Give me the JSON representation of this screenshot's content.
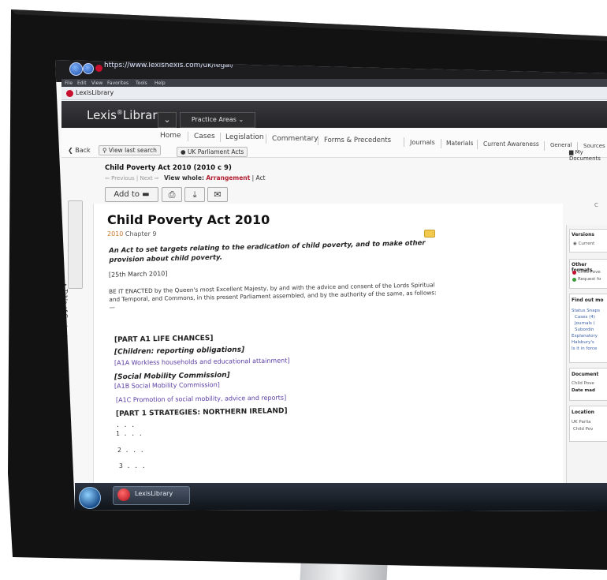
{
  "browser": {
    "url": "https://www.lexisnexis.com/uk/legal/",
    "menu": [
      "File",
      "Edit",
      "View",
      "Favorites",
      "Tools",
      "Help"
    ],
    "tab_title": "LexisLibrary"
  },
  "header": {
    "logo_main": "Lexis",
    "logo_reg": "®",
    "logo_suffix": "Library",
    "practice_areas": "Practice Areas ⌄",
    "chevron": "⌄"
  },
  "nav": {
    "items": [
      "Home",
      "Cases",
      "Legislation",
      "Commentary",
      "Forms & Precedents",
      "Journals",
      "Materials",
      "Current Awareness",
      "General",
      "Sources"
    ],
    "back": "Back",
    "view_last_search": "View last search",
    "breadcrumb": "UK Parliament Acts",
    "my_documents": "My Documents"
  },
  "document": {
    "short_title": "Child Poverty Act 2010 (2010 c 9)",
    "prev_next": "Previous | Next",
    "view_whole_label": "View whole:",
    "view_whole_arrangement": "Arrangement",
    "view_whole_act": "| Act",
    "add_to": "Add to",
    "toc": "Table of Contents",
    "title": "Child Poverty Act 2010",
    "chapter_year": "2010",
    "chapter": "Chapter 9",
    "intro": "An Act to set targets relating to the eradication of child poverty, and to make other provision about child poverty.",
    "date": "[25th March 2010]",
    "enacted": "BE IT ENACTED by the Queen's most Excellent Majesty, by and with the advice and consent of the Lords Spiritual and Temporal, and Commons, in this present Parliament assembled, and by the authority of the same, as follows:—",
    "part_a1": "[PART A1 LIFE CHANCES]",
    "children_heading": "[Children: reporting obligations]",
    "a1a_link": "[A1A Workless households and educational attainment]",
    "smc_heading": "[Social Mobility Commission]",
    "a1b_link": "[A1B Social Mobility Commission]",
    "a1c_link": "[A1C Promotion of social mobility, advice and reports]",
    "part_1": "[PART 1 STRATEGIES: NORTHERN IRELAND]",
    "ellipsis": ". . .",
    "s1": "1 . . .",
    "s2": "2 . . .",
    "s3": "3 . . ."
  },
  "sidebar": {
    "versions_h": "Versions",
    "versions_current": "Current",
    "other_formats_h": "Other formats",
    "other_formats_1": "Child Pove",
    "other_formats_2": "Request fo",
    "find_out_h": "Find out mo",
    "find_out_items": [
      "Status Snaps",
      "Cases (4)",
      "Journals (",
      "Subordin",
      "Explanatory",
      "Halsbury's",
      "Is it in force"
    ],
    "document_h": "Document",
    "document_1": "Child Pove",
    "document_2": "Date mad",
    "location_h": "Location",
    "location_1": "UK Parlia",
    "location_2": "Child Pov",
    "top_right": "C"
  },
  "taskbar": {
    "item_label": "LexisLibrary"
  }
}
